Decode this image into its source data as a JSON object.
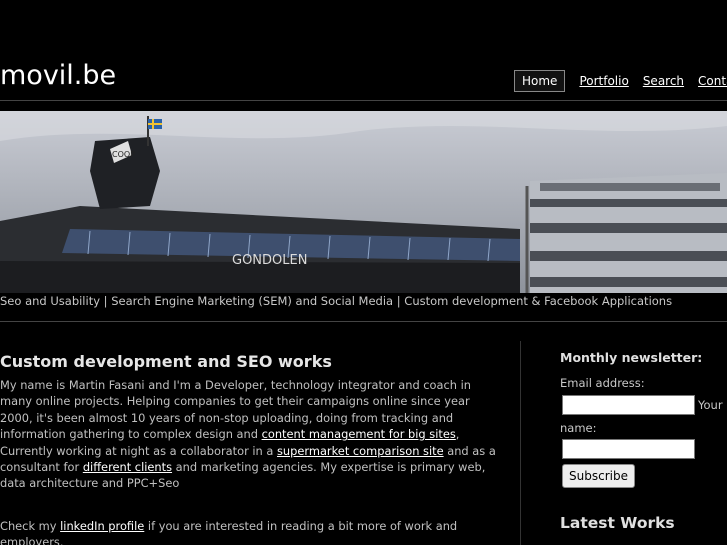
{
  "site": {
    "title": "movil.be"
  },
  "nav": {
    "home": "Home",
    "portfolio": "Portfolio",
    "search": "Search",
    "contact": "Contact"
  },
  "banner": {
    "sign_text": "GONDOLEN",
    "tower_sign": "COOP"
  },
  "tagline": "Seo and Usability | Search Engine Marketing (SEM) and Social Media | Custom development & Facebook Applications",
  "main": {
    "heading": "Custom development and SEO works",
    "p1_a": "My name is Martin Fasani and I'm a Developer, technology integrator and coach in many online projects. Helping companies to get their campaigns online since year 2000, it's been almost 10 years of non-stop uploading, doing from tracking and information gathering to complex design and ",
    "link_cms": "content management for big sites",
    "p1_b": ",",
    "p1_c": "Currently working at night as a collaborator in a ",
    "link_supermarket": "supermarket comparison site",
    "p1_d": " and as a consultant for ",
    "link_clients": "different clients",
    "p1_e": " and marketing agencies. My expertise is primary web, data architecture and PPC+Seo",
    "p2_a": "Check my ",
    "link_linkedin": "linkedIn profile",
    "p2_b": " if you are interested in reading a bit more of work and employers."
  },
  "sidebar": {
    "newsletter_title": "Monthly newsletter:",
    "email_label": "Email address:",
    "your_text": "Your",
    "name_label": "name:",
    "subscribe_label": "Subscribe",
    "latest_works": "Latest Works"
  }
}
